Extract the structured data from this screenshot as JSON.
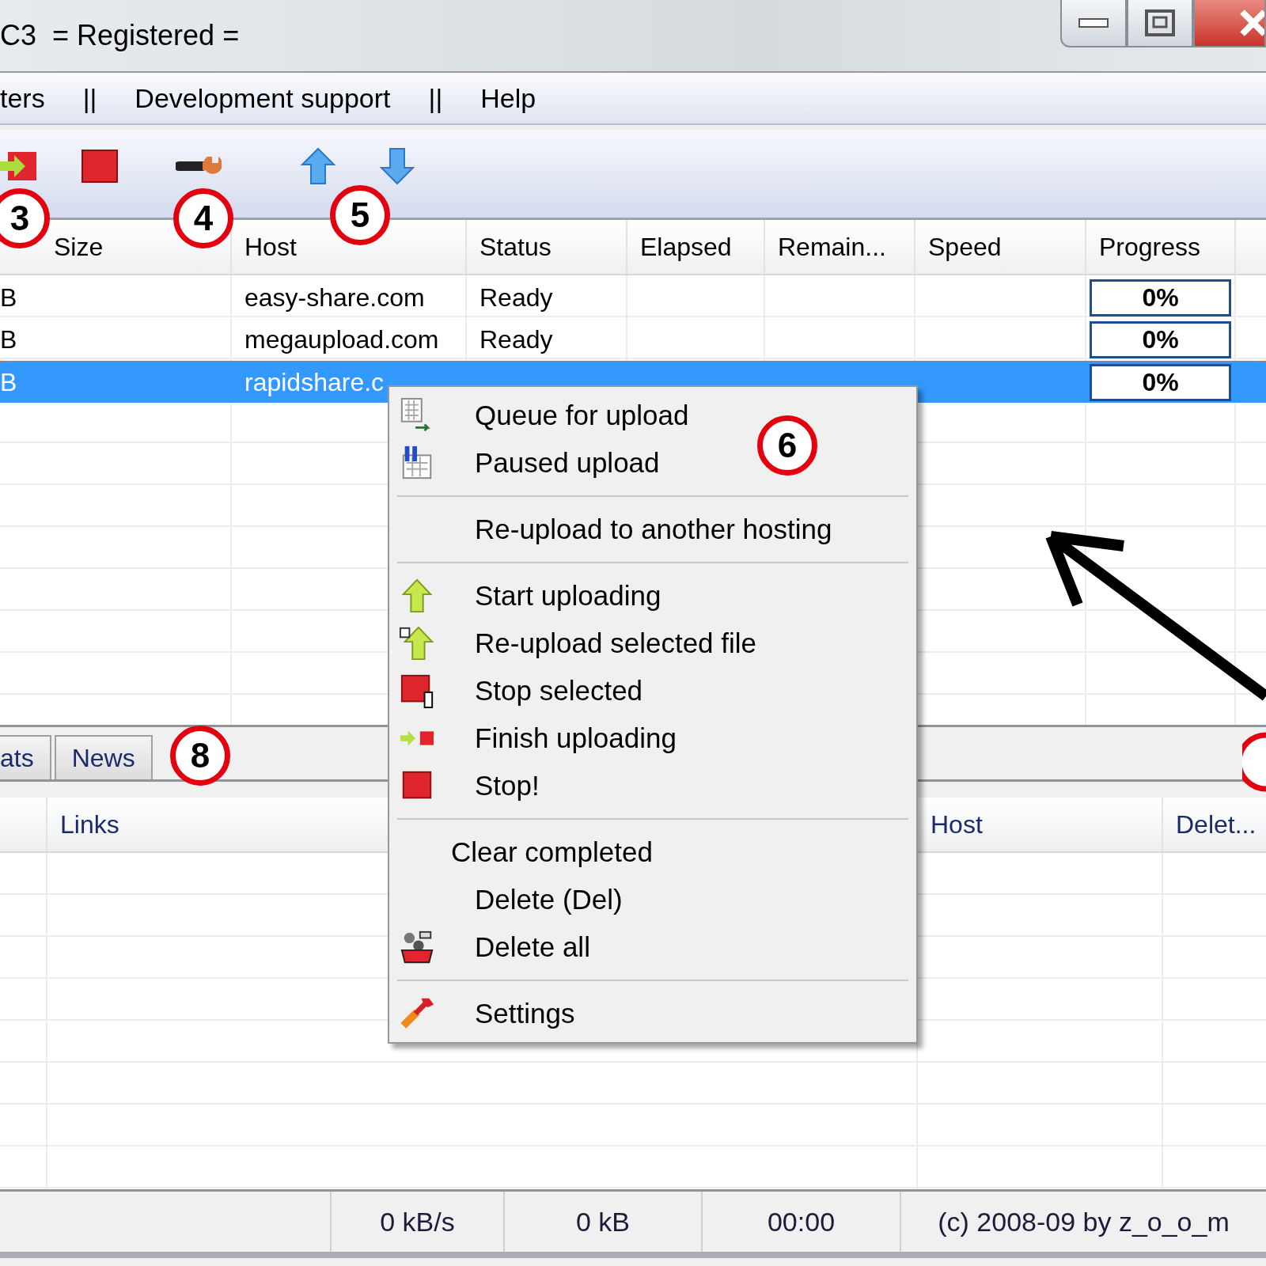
{
  "window": {
    "title": "C3  = Registered ="
  },
  "menu_bar": [
    "ters",
    "||",
    "Development support",
    "||",
    "Help"
  ],
  "table": {
    "columns": [
      "Size",
      "Host",
      "Status",
      "Elapsed",
      "Remain...",
      "Speed",
      "Progress"
    ],
    "rows": [
      {
        "size": "B",
        "host": "easy-share.com",
        "status": "Ready",
        "progress": "0%",
        "level": 0,
        "selected": false
      },
      {
        "size": "B",
        "host": "megaupload.com",
        "status": "Ready",
        "progress": "0%",
        "level": 0,
        "selected": false
      },
      {
        "size": "B",
        "host": "rapidshare.c",
        "progress": "0%",
        "level": 0,
        "selected": true
      }
    ]
  },
  "tabs": [
    {
      "label": "ats",
      "selected": false
    },
    {
      "label": "News",
      "selected": false
    }
  ],
  "links_table": {
    "columns": [
      "Links",
      "Host",
      "Delet..."
    ]
  },
  "status_bar": [
    "0 kB/s",
    "0 kB",
    "00:00",
    "(c) 2008-09 by z_o_o_m"
  ],
  "context_menu": [
    {
      "kind": "item",
      "label": "Queue for upload"
    },
    {
      "kind": "item",
      "label": "Paused upload"
    },
    {
      "kind": "separator"
    },
    {
      "kind": "item",
      "label": "Re-upload to another hosting"
    },
    {
      "kind": "separator"
    },
    {
      "kind": "item",
      "label": "Start uploading"
    },
    {
      "kind": "item",
      "label": "Re-upload selected file"
    },
    {
      "kind": "item",
      "label": "Stop selected"
    },
    {
      "kind": "item",
      "label": "Finish uploading"
    },
    {
      "kind": "item",
      "label": "Stop!"
    },
    {
      "kind": "separator"
    },
    {
      "kind": "plain",
      "label": "Clear completed"
    },
    {
      "kind": "item",
      "label": "Delete (Del)"
    },
    {
      "kind": "item",
      "label": "Delete all"
    },
    {
      "kind": "separator"
    },
    {
      "kind": "item",
      "label": "Settings"
    }
  ],
  "annotations": [
    {
      "label": "3"
    },
    {
      "label": "4"
    },
    {
      "label": "5"
    },
    {
      "label": "6"
    },
    {
      "label": "8"
    }
  ]
}
